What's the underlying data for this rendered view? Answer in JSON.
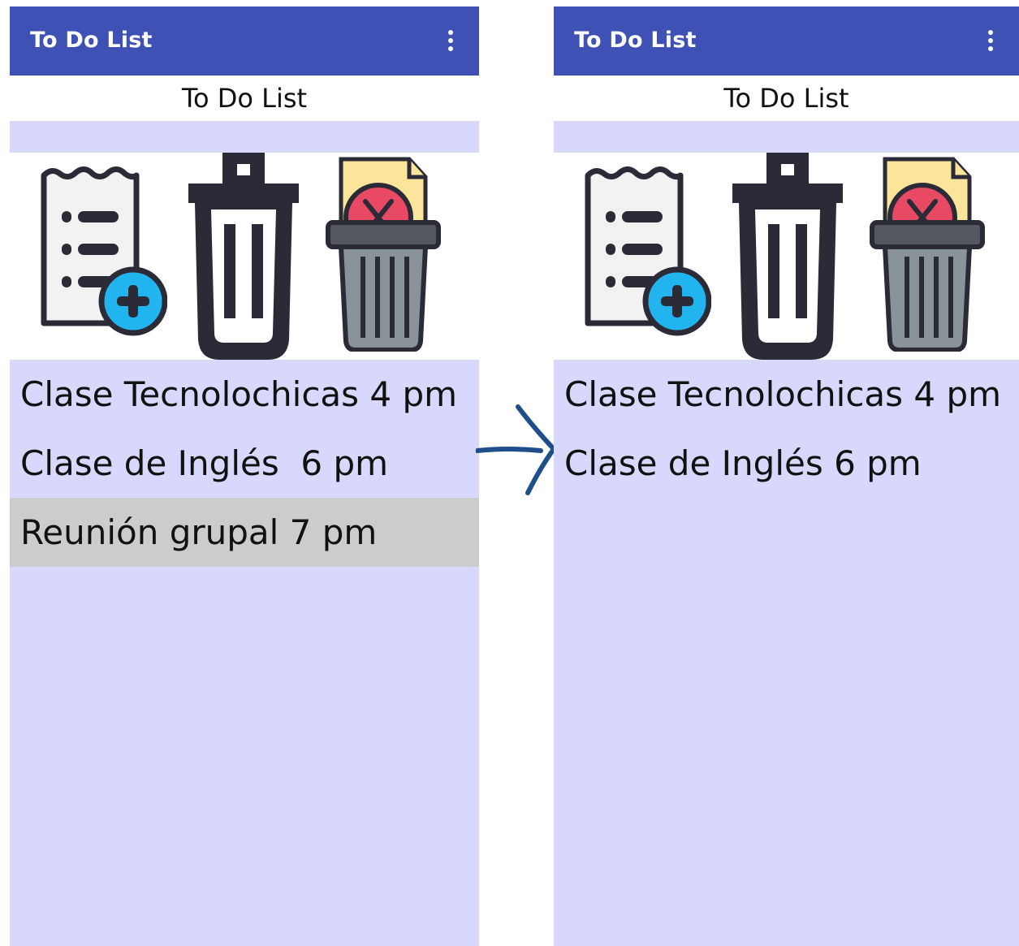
{
  "left_screen": {
    "appbar_title": "To Do List",
    "subtitle": "To Do List",
    "tasks": [
      {
        "label": "Clase Tecnolochicas 4 pm",
        "selected": false
      },
      {
        "label": "Clase de Inglés  6 pm",
        "selected": false
      },
      {
        "label": "Reunión grupal 7 pm",
        "selected": true
      }
    ]
  },
  "right_screen": {
    "appbar_title": "To Do List",
    "subtitle": "To Do List",
    "tasks": [
      {
        "label": "Clase Tecnolochicas 4 pm",
        "selected": false
      },
      {
        "label": "Clase de Inglés 6 pm",
        "selected": false
      }
    ]
  },
  "icons": [
    "add-task-icon",
    "trash-icon",
    "clear-all-icon",
    "overflow-menu-icon",
    "arrow-icon"
  ],
  "colors": {
    "appbar": "#3f51b5",
    "list_background": "#d8d8fc",
    "selected_row": "#cccccc",
    "arrow": "#1f4f8a"
  }
}
